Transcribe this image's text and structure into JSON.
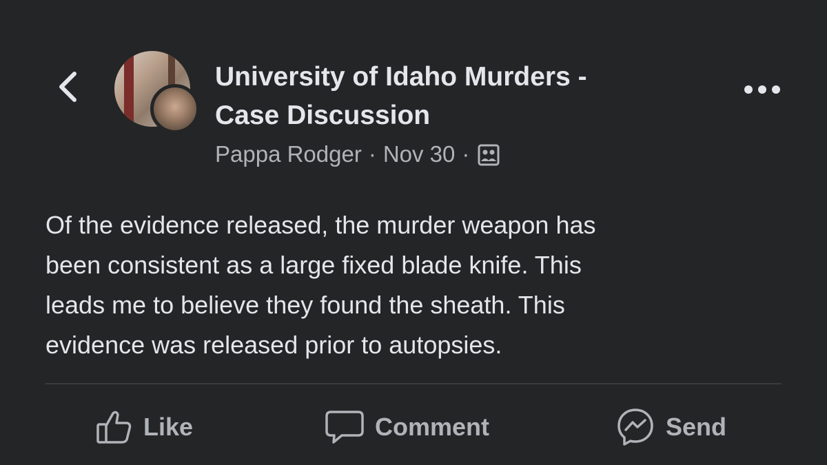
{
  "header": {
    "back_icon": "chevron-left-icon",
    "group_name": "University of Idaho Murders -\nCase Discussion",
    "author": "Pappa Rodger",
    "separator": "·",
    "date": "Nov 30",
    "audience_icon": "members-icon",
    "more_icon": "more-horizontal-icon"
  },
  "post": {
    "text": "Of the evidence released, the murder weapon has\nbeen consistent as a large fixed blade knife.  This\nleads me to believe they found the sheath.  This\nevidence was released prior to autopsies."
  },
  "actions": [
    {
      "label": "Like",
      "icon": "thumbs-up-icon"
    },
    {
      "label": "Comment",
      "icon": "comment-icon"
    },
    {
      "label": "Send",
      "icon": "messenger-icon"
    }
  ],
  "colors": {
    "background": "#242526",
    "primary_text": "#e4e6eb",
    "secondary_text": "#b0b3b8",
    "divider": "#3a3b3c"
  }
}
